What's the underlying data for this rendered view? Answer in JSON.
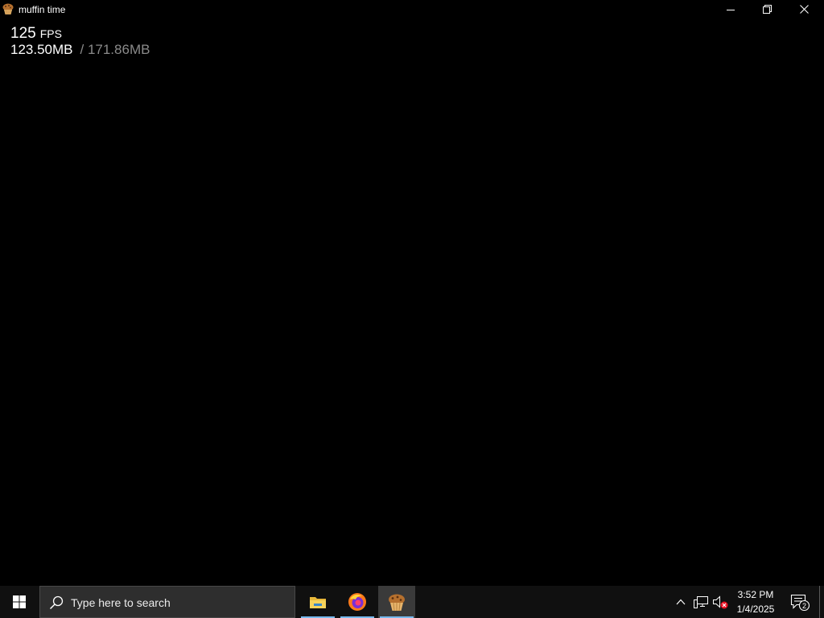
{
  "window": {
    "title": "muffin time",
    "icon": "muffin-icon",
    "controls": [
      "minimize-icon",
      "restore-icon",
      "close-icon"
    ]
  },
  "overlay": {
    "fps_value": "125",
    "fps_unit": "FPS",
    "memory_used": "123.50MB",
    "memory_total": "/ 171.86MB"
  },
  "taskbar": {
    "search_placeholder": "Type here to search",
    "pinned_apps": [
      "file-explorer-icon",
      "firefox-icon",
      "muffin-app-icon"
    ],
    "active_app": "muffin time",
    "clock_time": "3:52 PM",
    "clock_date": "1/4/2025",
    "notification_count": "2",
    "accent_color": "#76b9ed"
  }
}
